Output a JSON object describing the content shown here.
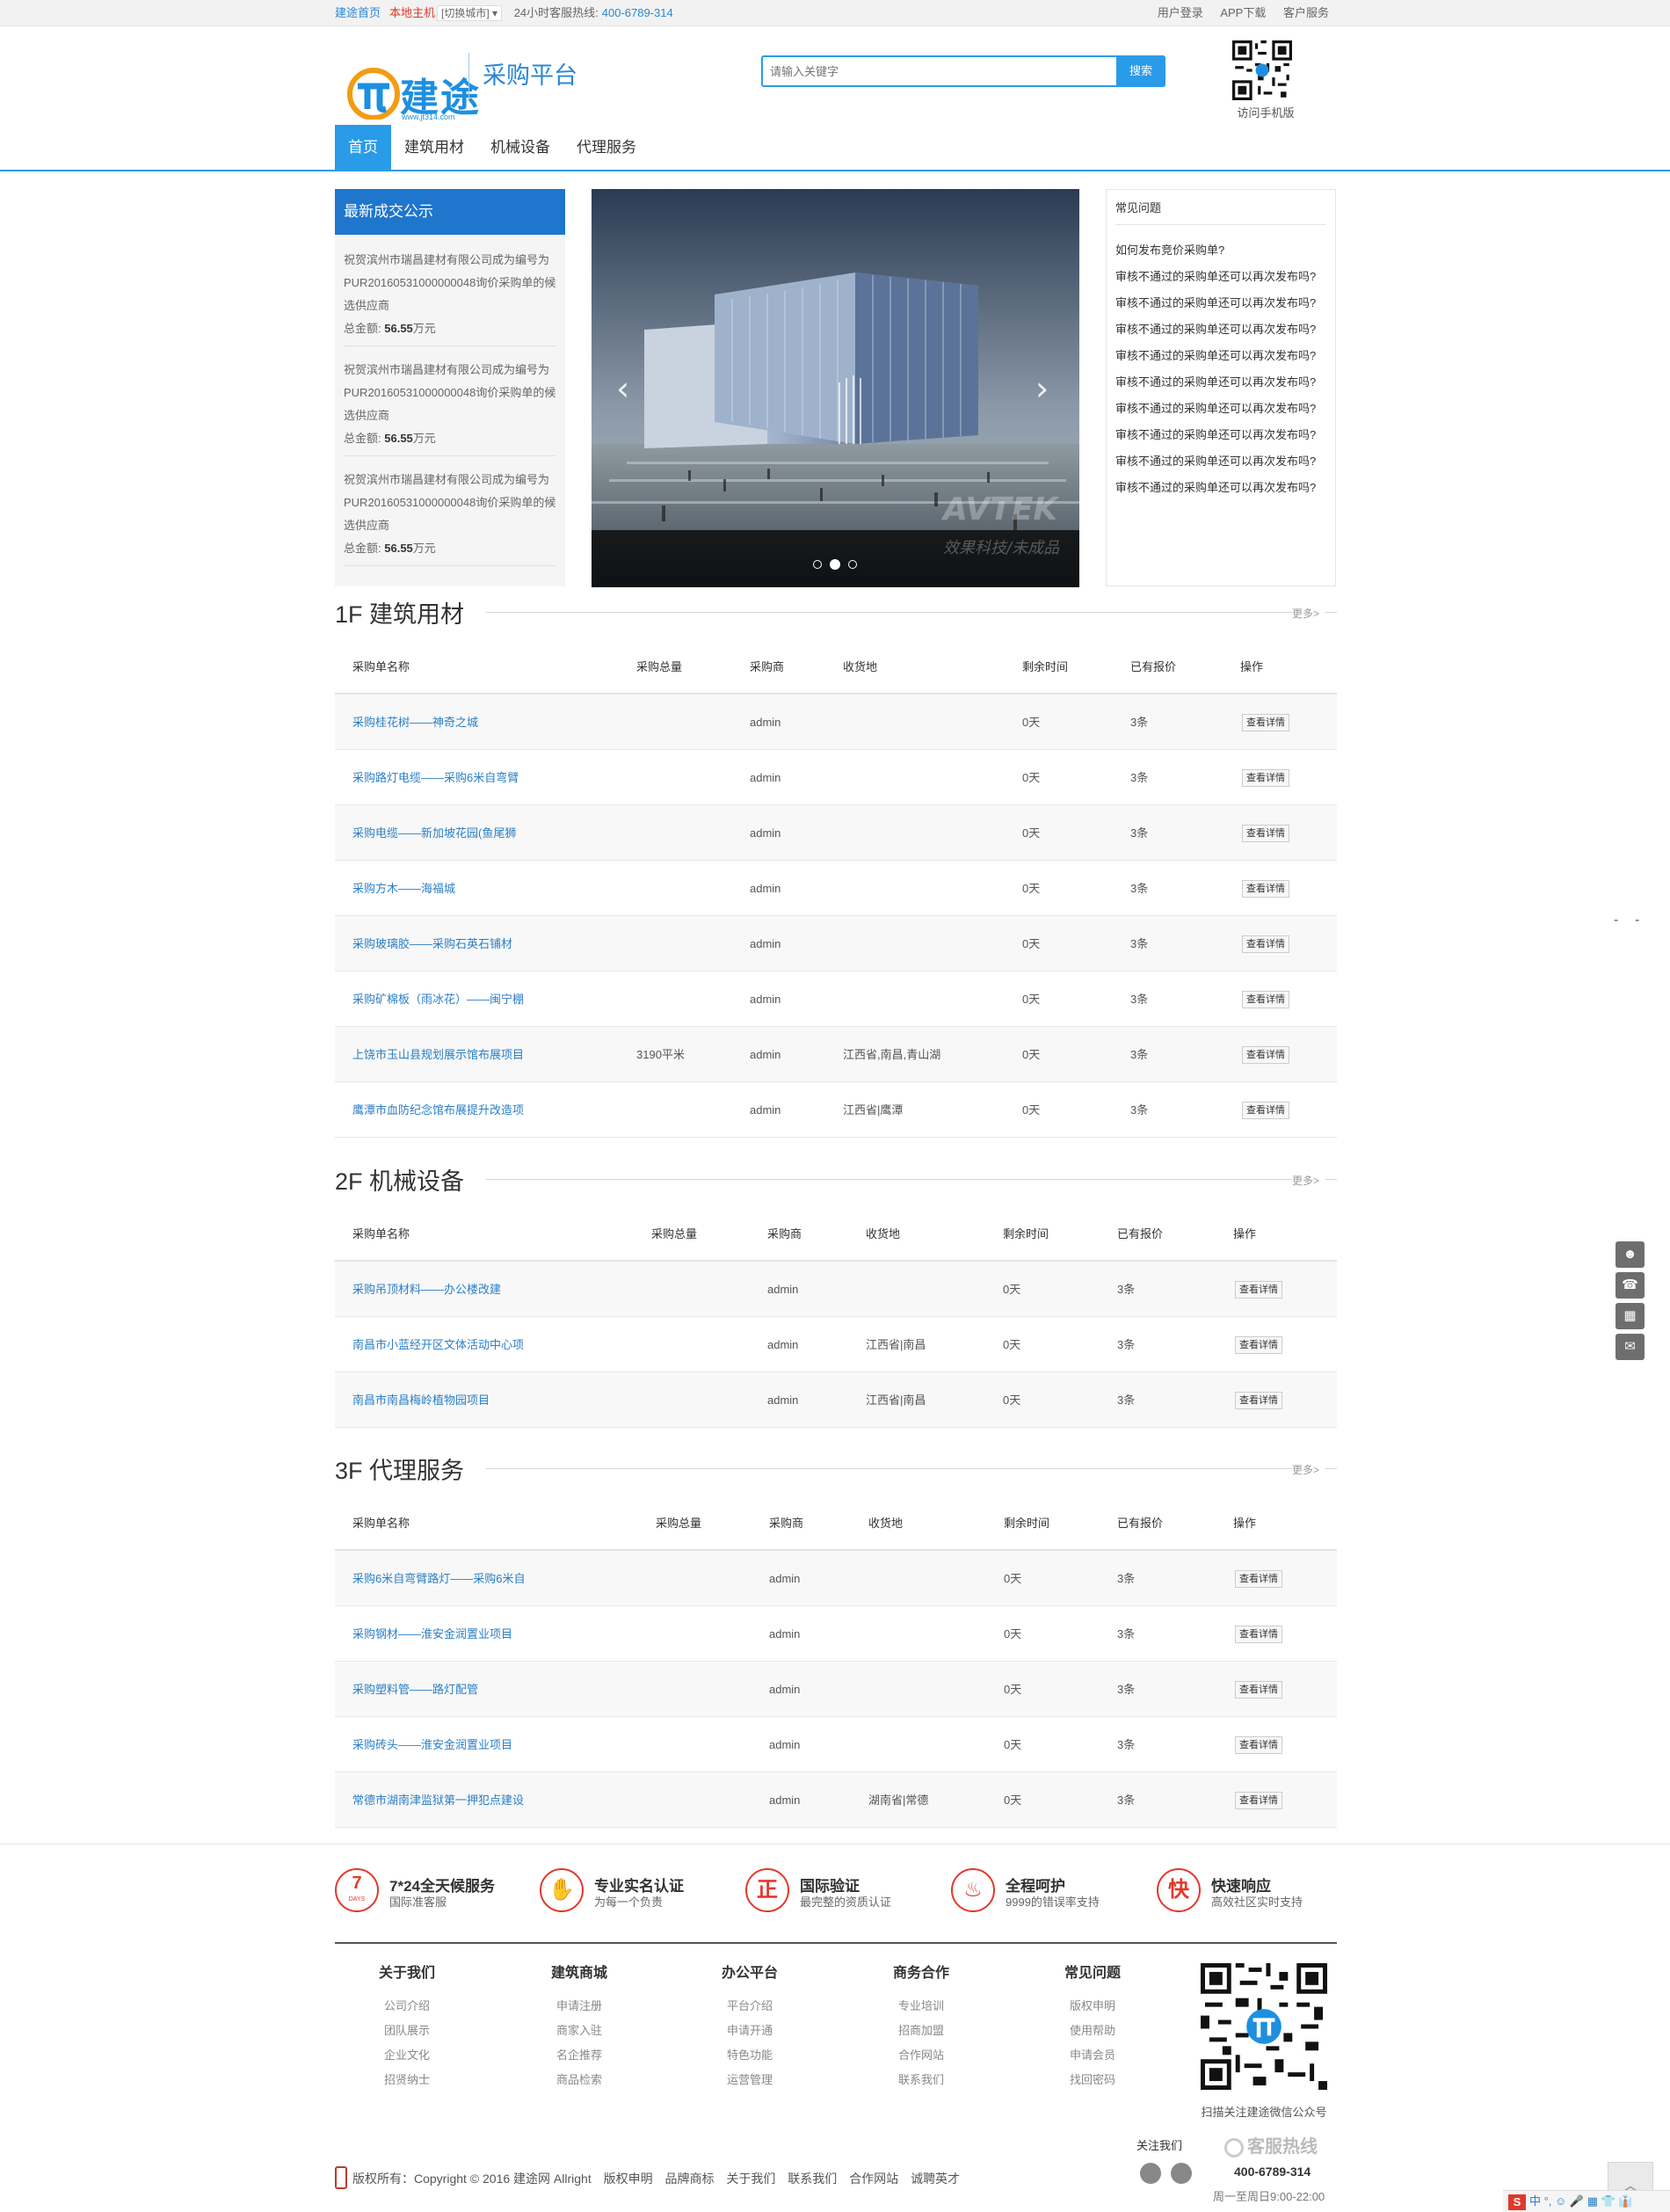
{
  "topbar": {
    "home": "建途首页",
    "city": "本地主机",
    "switch": "[切换城市] ▾",
    "hotline_label": "24小时客服热线:",
    "hotline": "400-6789-314",
    "login": "用户登录",
    "app": "APP下载",
    "service": "客户服务"
  },
  "header": {
    "logo_text": "建途",
    "logo_url": "www.jt314.com",
    "platform": "采购平台",
    "search_placeholder": "请输入关键字",
    "search_button": "搜索",
    "qr_caption": "访问手机版"
  },
  "nav": [
    "首页",
    "建筑用材",
    "机械设备",
    "代理服务"
  ],
  "notice": {
    "title": "最新成交公示",
    "entries": [
      {
        "text": "祝贺滨州市瑞昌建材有限公司成为编号为PUR20160531000000048询价采购单的候选供应商",
        "amount_label": "总金额:",
        "amount": "56.55",
        "unit": "万元"
      },
      {
        "text": "祝贺滨州市瑞昌建材有限公司成为编号为PUR20160531000000048询价采购单的候选供应商",
        "amount_label": "总金额:",
        "amount": "56.55",
        "unit": "万元"
      },
      {
        "text": "祝贺滨州市瑞昌建材有限公司成为编号为PUR20160531000000048询价采购单的候选供应商",
        "amount_label": "总金额:",
        "amount": "56.55",
        "unit": "万元"
      }
    ]
  },
  "banner": {
    "watermark": "AVTEK",
    "watermark_sub": "效果科技/未成品",
    "slide_index": 2,
    "slide_count": 3
  },
  "faq": {
    "title": "常见问题",
    "items": [
      "如何发布竞价采购单?",
      "审核不通过的采购单还可以再次发布吗?",
      "审核不通过的采购单还可以再次发布吗?",
      "审核不通过的采购单还可以再次发布吗?",
      "审核不通过的采购单还可以再次发布吗?",
      "审核不通过的采购单还可以再次发布吗?",
      "审核不通过的采购单还可以再次发布吗?",
      "审核不通过的采购单还可以再次发布吗?",
      "审核不通过的采购单还可以再次发布吗?",
      "审核不通过的采购单还可以再次发布吗?"
    ]
  },
  "columns": [
    "采购单名称",
    "采购总量",
    "采购商",
    "收货地",
    "剩余时间",
    "已有报价",
    "操作"
  ],
  "more": "更多>",
  "detail_label": "查看详情",
  "sections": [
    {
      "title": "1F 建筑用材",
      "rows": [
        {
          "name": "采购桂花树——神奇之城",
          "qty": "",
          "buyer": "admin",
          "place": "",
          "remain": "0天",
          "quotes": "3条"
        },
        {
          "name": "采购路灯电缆——采购6米自弯臂",
          "qty": "",
          "buyer": "admin",
          "place": "",
          "remain": "0天",
          "quotes": "3条"
        },
        {
          "name": "采购电缆——新加坡花园(鱼尾狮",
          "qty": "",
          "buyer": "admin",
          "place": "",
          "remain": "0天",
          "quotes": "3条"
        },
        {
          "name": "采购方木——海福城",
          "qty": "",
          "buyer": "admin",
          "place": "",
          "remain": "0天",
          "quotes": "3条"
        },
        {
          "name": "采购玻璃胶——采购石英石铺材",
          "qty": "",
          "buyer": "admin",
          "place": "",
          "remain": "0天",
          "quotes": "3条"
        },
        {
          "name": "采购矿棉板（雨冰花）——闽宁棚",
          "qty": "",
          "buyer": "admin",
          "place": "",
          "remain": "0天",
          "quotes": "3条"
        },
        {
          "name": "上饶市玉山县规划展示馆布展项目",
          "qty": "3190平米",
          "buyer": "admin",
          "place": "江西省,南昌,青山湖",
          "remain": "0天",
          "quotes": "3条"
        },
        {
          "name": "鹰潭市血防纪念馆布展提升改造项",
          "qty": "",
          "buyer": "admin",
          "place": "江西省|鹰潭",
          "remain": "0天",
          "quotes": "3条"
        }
      ]
    },
    {
      "title": "2F 机械设备",
      "rows": [
        {
          "name": "采购吊顶材料——办公楼改建",
          "qty": "",
          "buyer": "admin",
          "place": "",
          "remain": "0天",
          "quotes": "3条"
        },
        {
          "name": "南昌市小蓝经开区文体活动中心项",
          "qty": "",
          "buyer": "admin",
          "place": "江西省|南昌",
          "remain": "0天",
          "quotes": "3条"
        },
        {
          "name": "南昌市南昌梅岭植物园项目",
          "qty": "",
          "buyer": "admin",
          "place": "江西省|南昌",
          "remain": "0天",
          "quotes": "3条"
        }
      ]
    },
    {
      "title": "3F 代理服务",
      "rows": [
        {
          "name": "采购6米自弯臂路灯——采购6米自",
          "qty": "",
          "buyer": "admin",
          "place": "",
          "remain": "0天",
          "quotes": "3条"
        },
        {
          "name": "采购钢材——淮安金润置业项目",
          "qty": "",
          "buyer": "admin",
          "place": "",
          "remain": "0天",
          "quotes": "3条"
        },
        {
          "name": "采购塑料管——路灯配管",
          "qty": "",
          "buyer": "admin",
          "place": "",
          "remain": "0天",
          "quotes": "3条"
        },
        {
          "name": "采购砖头——淮安金润置业项目",
          "qty": "",
          "buyer": "admin",
          "place": "",
          "remain": "0天",
          "quotes": "3条"
        },
        {
          "name": "常德市湖南津监狱第一押犯点建设",
          "qty": "",
          "buyer": "admin",
          "place": "湖南省|常德",
          "remain": "0天",
          "quotes": "3条"
        }
      ]
    }
  ],
  "services": [
    {
      "icon": "7",
      "icon_sub": "DAYS",
      "title": "7*24全天候服务",
      "sub": "国际准客服"
    },
    {
      "icon": "✋",
      "icon_sub": "",
      "title": "专业实名认证",
      "sub": "为每一个负责"
    },
    {
      "icon": "正",
      "icon_sub": "",
      "title": "国际验证",
      "sub": "最完整的资质认证"
    },
    {
      "icon": "♨",
      "icon_sub": "",
      "title": "全程呵护",
      "sub": "9999的错误率支持"
    },
    {
      "icon": "快",
      "icon_sub": "",
      "title": "快速响应",
      "sub": "高效社区实时支持"
    }
  ],
  "footer_cols": [
    {
      "title": "关于我们",
      "links": [
        "公司介绍",
        "团队展示",
        "企业文化",
        "招贤纳士"
      ]
    },
    {
      "title": "建筑商城",
      "links": [
        "申请注册",
        "商家入驻",
        "名企推荐",
        "商品检索"
      ]
    },
    {
      "title": "办公平台",
      "links": [
        "平台介绍",
        "申请开通",
        "特色功能",
        "运营管理"
      ]
    },
    {
      "title": "商务合作",
      "links": [
        "专业培训",
        "招商加盟",
        "合作网站",
        "联系我们"
      ]
    },
    {
      "title": "常见问题",
      "links": [
        "版权申明",
        "使用帮助",
        "申请会员",
        "找回密码"
      ]
    }
  ],
  "qr_caption": "扫描关注建途微信公众号",
  "bottom": {
    "copyright": "版权所有：Copyright © 2016 建途网 Allright",
    "links": [
      "版权申明",
      "品牌商标",
      "关于我们",
      "联系我们",
      "合作网站",
      "诚聘英才"
    ],
    "follow": "关注我们",
    "hotline_title": "客服热线",
    "hotline": "400-6789-314",
    "hours": "周一至周日9:00-22:00"
  },
  "ime": {
    "logo": "S",
    "text": "中 °, ☺ 🎤 ▦ 👕 👔"
  },
  "colors": {
    "primary": "#2a9be8",
    "notice_head": "#1f76cd",
    "accent_red": "#e2382b",
    "link": "#2a7ec6"
  }
}
